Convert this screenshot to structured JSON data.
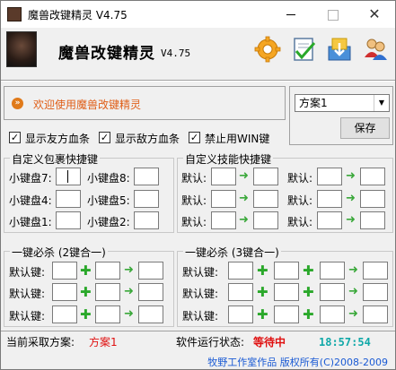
{
  "window": {
    "title": "魔兽改键精灵 V4.75",
    "close_glyph": "✕"
  },
  "header": {
    "app_name": "魔兽改键精灵",
    "version": "V4.75",
    "icons": [
      "gear-icon",
      "checklist-icon",
      "download-icon",
      "users-icon"
    ]
  },
  "welcome": {
    "text": "欢迎使用魔兽改键精灵"
  },
  "scheme": {
    "selected": "方案1",
    "save_label": "保存"
  },
  "options": [
    {
      "label": "显示友方血条",
      "checked": true
    },
    {
      "label": "显示敌方血条",
      "checked": true
    },
    {
      "label": "禁止用WIN键",
      "checked": true
    }
  ],
  "item_group": {
    "title": "自定义包裹快捷键",
    "slots": [
      {
        "label": "小键盘7:",
        "value": ""
      },
      {
        "label": "小键盘8:",
        "value": ""
      },
      {
        "label": "小键盘4:",
        "value": ""
      },
      {
        "label": "小键盘5:",
        "value": ""
      },
      {
        "label": "小键盘1:",
        "value": ""
      },
      {
        "label": "小键盘2:",
        "value": ""
      }
    ]
  },
  "skill_group": {
    "title": "自定义技能快捷键",
    "rows": [
      {
        "label": "默认:"
      },
      {
        "label": "默认:"
      },
      {
        "label": "默认:"
      }
    ]
  },
  "combo2": {
    "title": "一键必杀 (2键合一)",
    "row_label": "默认键:"
  },
  "combo3": {
    "title": "一键必杀 (3键合一)",
    "row_label": "默认键:"
  },
  "status": {
    "current_label": "当前采取方案:",
    "current_value": "方案1",
    "run_label": "软件运行状态:",
    "run_value": "等待中",
    "clock": "18:57:54"
  },
  "footer": {
    "text": "牧野工作室作品 版权所有(C)2008-2009"
  },
  "colors": {
    "accent_orange": "#e0601a",
    "status_red": "#e01010",
    "clock_cyan": "#10a8a8",
    "link_blue": "#1a5ad4",
    "plus_green": "#2aa82a"
  }
}
